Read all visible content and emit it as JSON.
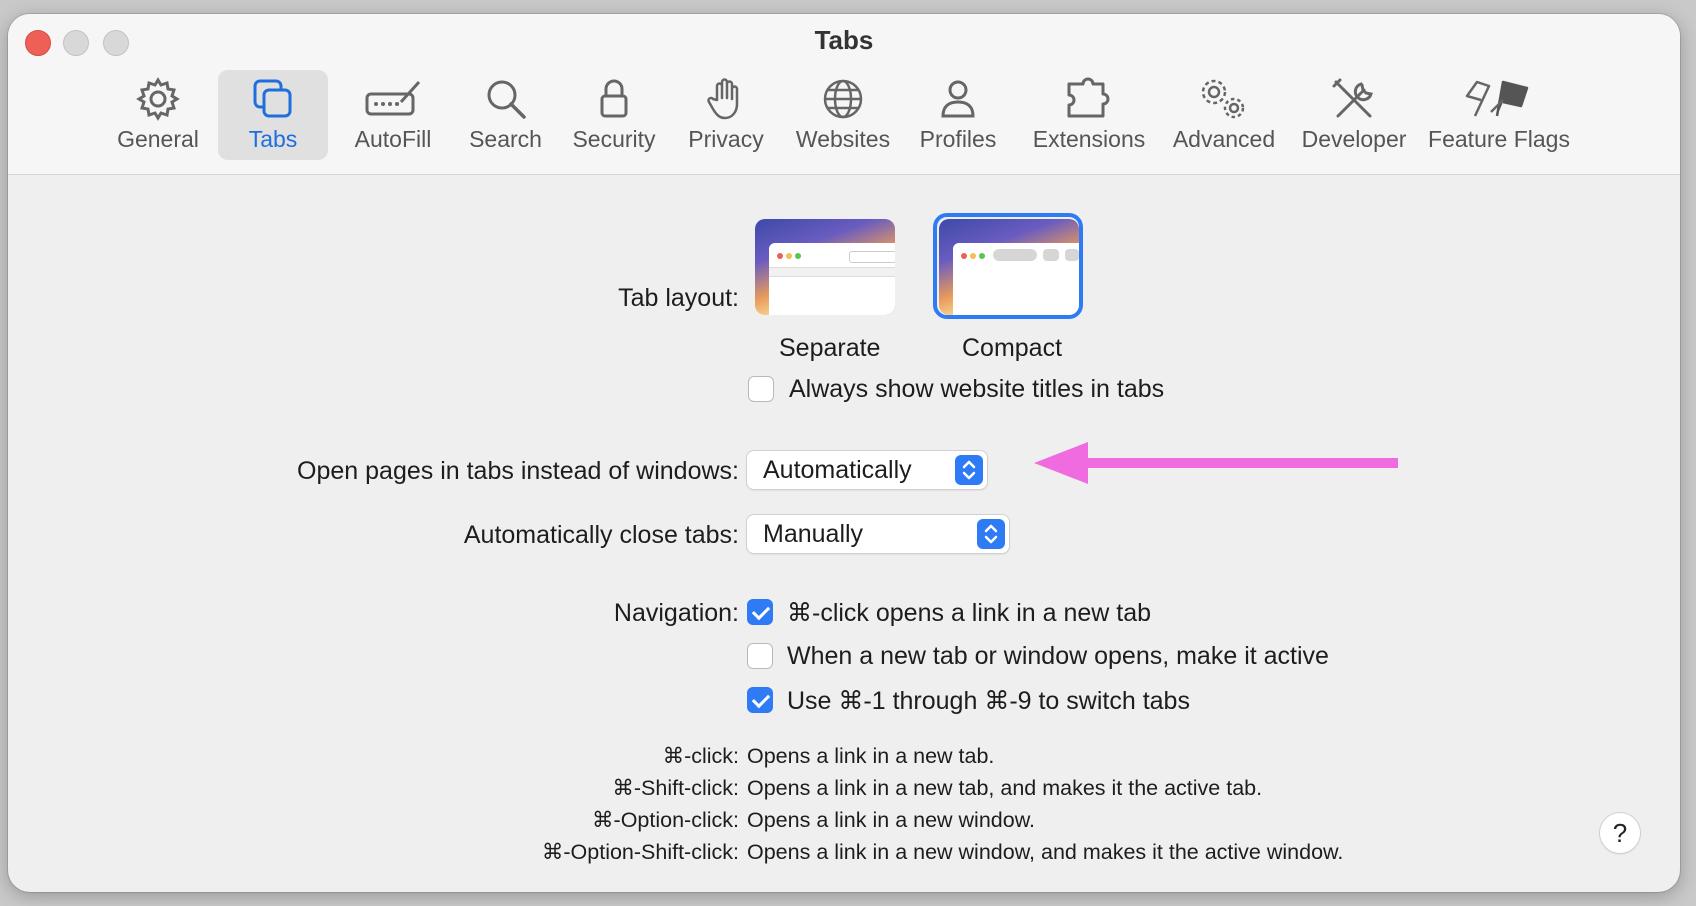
{
  "window": {
    "title": "Tabs"
  },
  "toolbar": {
    "items": [
      {
        "label": "General",
        "icon": "gear-icon"
      },
      {
        "label": "Tabs",
        "icon": "tabs-icon",
        "active": true
      },
      {
        "label": "AutoFill",
        "icon": "pencil-field-icon"
      },
      {
        "label": "Search",
        "icon": "magnifier-icon"
      },
      {
        "label": "Security",
        "icon": "lock-icon"
      },
      {
        "label": "Privacy",
        "icon": "hand-icon"
      },
      {
        "label": "Websites",
        "icon": "globe-icon"
      },
      {
        "label": "Profiles",
        "icon": "person-icon"
      },
      {
        "label": "Extensions",
        "icon": "puzzle-icon"
      },
      {
        "label": "Advanced",
        "icon": "gears-icon"
      },
      {
        "label": "Developer",
        "icon": "tools-icon"
      },
      {
        "label": "Feature Flags",
        "icon": "flags-icon"
      }
    ]
  },
  "tab_layout": {
    "label": "Tab layout:",
    "options": [
      {
        "label": "Separate",
        "selected": false
      },
      {
        "label": "Compact",
        "selected": true
      }
    ],
    "always_show_titles": {
      "label": "Always show website titles in tabs",
      "checked": false
    }
  },
  "open_pages": {
    "label": "Open pages in tabs instead of windows:",
    "value": "Automatically"
  },
  "auto_close": {
    "label": "Automatically close tabs:",
    "value": "Manually"
  },
  "navigation": {
    "label": "Navigation:",
    "options": [
      {
        "label": "⌘-click opens a link in a new tab",
        "checked": true
      },
      {
        "label": "When a new tab or window opens, make it active",
        "checked": false
      },
      {
        "label": "Use ⌘-1 through ⌘-9 to switch tabs",
        "checked": true
      }
    ]
  },
  "shortcuts": [
    {
      "key": "⌘-click:",
      "desc": "Opens a link in a new tab."
    },
    {
      "key": "⌘-Shift-click:",
      "desc": "Opens a link in a new tab, and makes it the active tab."
    },
    {
      "key": "⌘-Option-click:",
      "desc": "Opens a link in a new window."
    },
    {
      "key": "⌘-Option-Shift-click:",
      "desc": "Opens a link in a new window, and makes it the active window."
    }
  ],
  "help": {
    "label": "?"
  },
  "colors": {
    "accent": "#2f7bf5",
    "annotation_arrow": "#f06be0",
    "close": "#ee5f58"
  }
}
